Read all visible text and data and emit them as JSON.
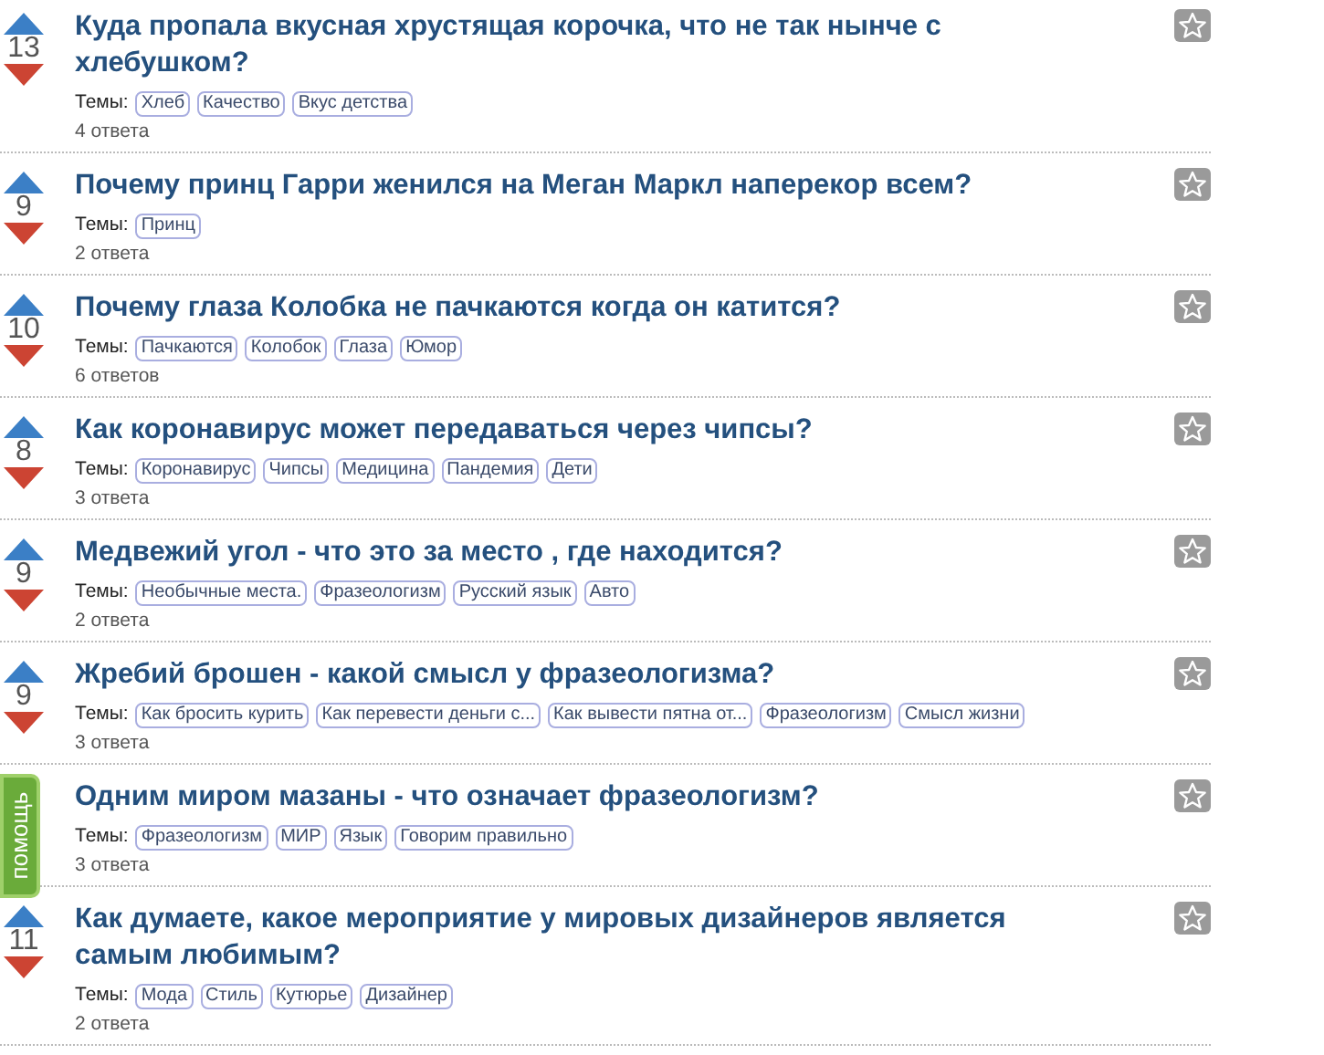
{
  "help_tab": {
    "label": "помощь"
  },
  "questions": [
    {
      "votes": "13",
      "title": "Куда пропала вкусная хрустящая корочка, что не так нынче с хлебушком?",
      "topics_label": "Темы:",
      "tags": [
        "Хлеб",
        "Качество",
        "Вкус детства"
      ],
      "answers": "4 ответа"
    },
    {
      "votes": "9",
      "title": "Почему принц Гарри женился на Меган Маркл наперекор всем?",
      "topics_label": "Темы:",
      "tags": [
        "Принц"
      ],
      "answers": "2 ответа"
    },
    {
      "votes": "10",
      "title": "Почему глаза Колобка не пачкаются когда он катится?",
      "topics_label": "Темы:",
      "tags": [
        "Пачкаются",
        "Колобок",
        "Глаза",
        "Юмор"
      ],
      "answers": "6 ответов"
    },
    {
      "votes": "8",
      "title": "Как коронавирус может передаваться через чипсы?",
      "topics_label": "Темы:",
      "tags": [
        "Коронавирус",
        "Чипсы",
        "Медицина",
        "Пандемия",
        "Дети"
      ],
      "answers": "3 ответа"
    },
    {
      "votes": "9",
      "title": "Медвежий угол - что это за место , где находится?",
      "topics_label": "Темы:",
      "tags": [
        "Необычные места.",
        "Фразеологизм",
        "Русский язык",
        "Авто"
      ],
      "answers": "2 ответа"
    },
    {
      "votes": "9",
      "title": "Жребий брошен - какой смысл у фразеологизма?",
      "topics_label": "Темы:",
      "tags": [
        "Как бросить курить",
        "Как перевести деньги с...",
        "Как вывести пятна от...",
        "Фразеологизм",
        "Смысл жизни"
      ],
      "answers": "3 ответа"
    },
    {
      "title": "Одним миром мазаны - что означает фразеологизм?",
      "topics_label": "Темы:",
      "tags": [
        "Фразеологизм",
        "МИР",
        "Язык",
        "Говорим правильно"
      ],
      "answers": "3 ответа"
    },
    {
      "votes": "11",
      "title": "Как думаете, какое мероприятие у мировых дизайнеров является самым любимым?",
      "topics_label": "Темы:",
      "tags": [
        "Мода",
        "Стиль",
        "Кутюрье",
        "Дизайнер"
      ],
      "answers": "2 ответа"
    }
  ]
}
